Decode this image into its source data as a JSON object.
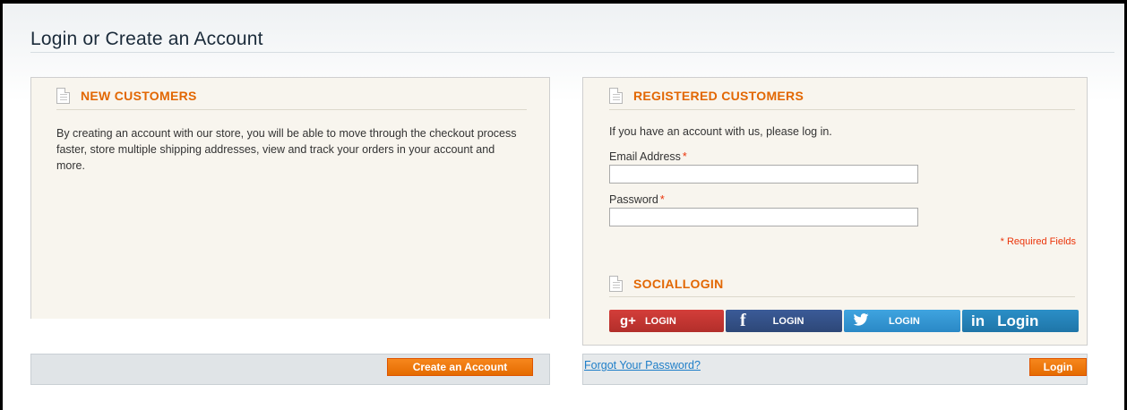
{
  "page": {
    "title": "Login or Create an Account"
  },
  "new_customers": {
    "title": "NEW CUSTOMERS",
    "description": "By creating an account with our store, you will be able to move through the checkout process faster, store multiple shipping addresses, view and track your orders in your account and more.",
    "create_button": "Create an Account"
  },
  "registered": {
    "title": "REGISTERED CUSTOMERS",
    "intro": "If you have an account with us, please log in.",
    "email_label": "Email Address",
    "password_label": "Password",
    "required_marker": "*",
    "email_value": "",
    "password_value": "",
    "required_note": "* Required Fields",
    "forgot_link": "Forgot Your Password?",
    "login_button": "Login"
  },
  "social": {
    "title": "SOCIALLOGIN",
    "buttons": [
      {
        "icon": "g+",
        "label": "LOGIN",
        "provider": "google-plus",
        "color": "#c9342f"
      },
      {
        "icon": "f",
        "label": "LOGIN",
        "provider": "facebook",
        "color": "#3b5b98"
      },
      {
        "icon": "🐦",
        "label": "LOGIN",
        "provider": "twitter",
        "color": "#3fa4e0"
      },
      {
        "icon": "in",
        "label": "Login",
        "provider": "linkedin",
        "color": "#2b8fc7"
      }
    ]
  },
  "colors": {
    "accent": "#e26703",
    "button": "#f7871d",
    "link": "#1e7ec8",
    "required": "#eb340a"
  }
}
